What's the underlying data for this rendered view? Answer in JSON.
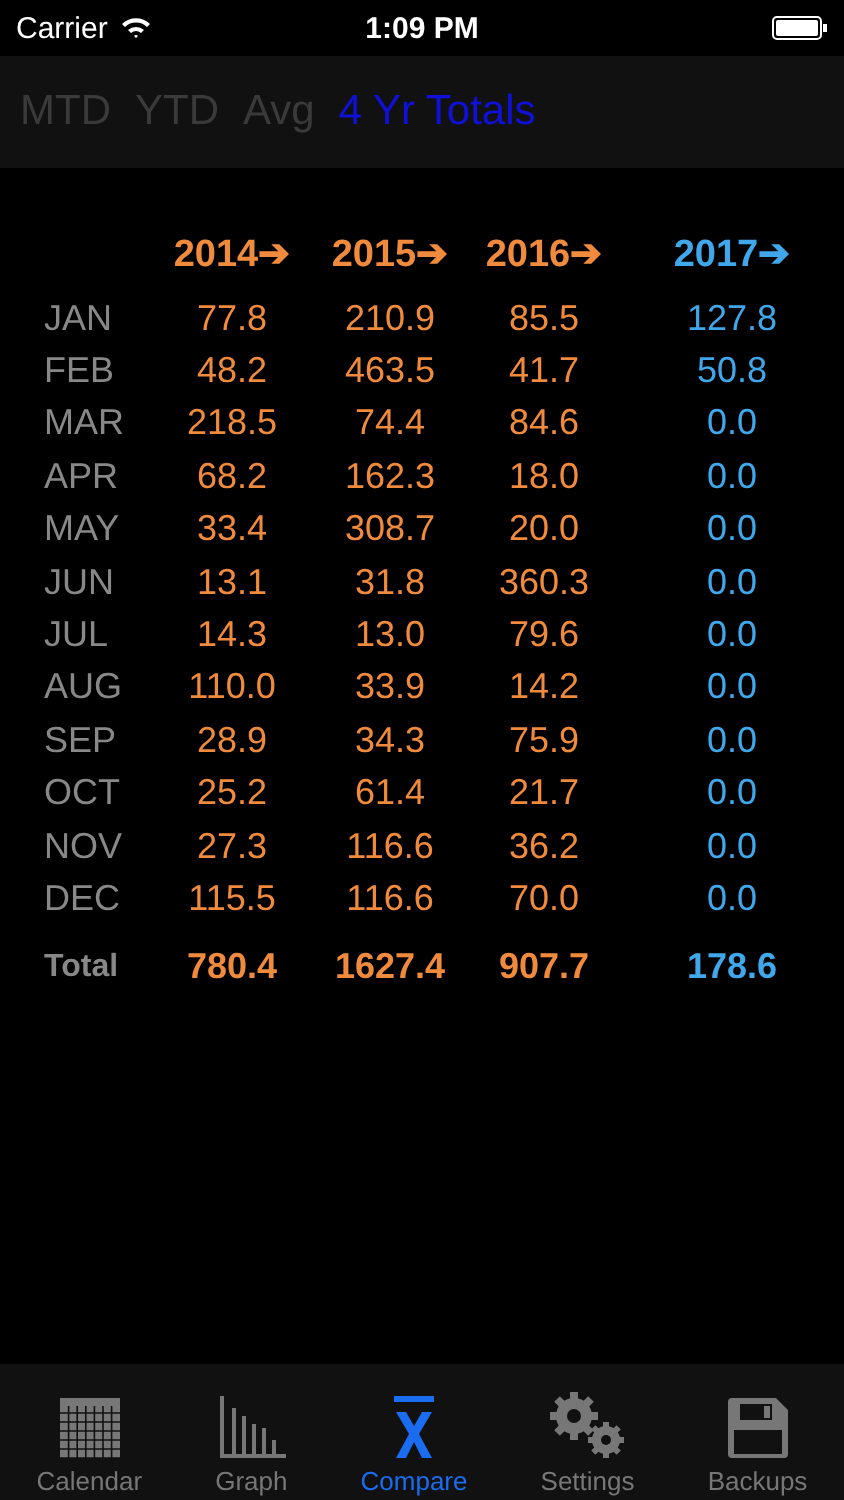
{
  "status_bar": {
    "carrier": "Carrier",
    "time": "1:09 PM"
  },
  "segments": [
    {
      "label": "MTD",
      "selected": false
    },
    {
      "label": "YTD",
      "selected": false
    },
    {
      "label": "Avg",
      "selected": false
    },
    {
      "label": "4 Yr Totals",
      "selected": true
    }
  ],
  "table": {
    "columns": [
      {
        "label": "2014➔",
        "current": false
      },
      {
        "label": "2015➔",
        "current": false
      },
      {
        "label": "2016➔",
        "current": false
      },
      {
        "label": "2017➔",
        "current": true
      }
    ],
    "rows": [
      {
        "month": "JAN",
        "values": [
          "77.8",
          "210.9",
          "85.5",
          "127.8"
        ]
      },
      {
        "month": "FEB",
        "values": [
          "48.2",
          "463.5",
          "41.7",
          "50.8"
        ]
      },
      {
        "month": "MAR",
        "values": [
          "218.5",
          "74.4",
          "84.6",
          "0.0"
        ]
      },
      {
        "month": "APR",
        "values": [
          "68.2",
          "162.3",
          "18.0",
          "0.0"
        ]
      },
      {
        "month": "MAY",
        "values": [
          "33.4",
          "308.7",
          "20.0",
          "0.0"
        ]
      },
      {
        "month": "JUN",
        "values": [
          "13.1",
          "31.8",
          "360.3",
          "0.0"
        ]
      },
      {
        "month": "JUL",
        "values": [
          "14.3",
          "13.0",
          "79.6",
          "0.0"
        ]
      },
      {
        "month": "AUG",
        "values": [
          "110.0",
          "33.9",
          "14.2",
          "0.0"
        ]
      },
      {
        "month": "SEP",
        "values": [
          "28.9",
          "34.3",
          "75.9",
          "0.0"
        ]
      },
      {
        "month": "OCT",
        "values": [
          "25.2",
          "61.4",
          "21.7",
          "0.0"
        ]
      },
      {
        "month": "NOV",
        "values": [
          "27.3",
          "116.6",
          "36.2",
          "0.0"
        ]
      },
      {
        "month": "DEC",
        "values": [
          "115.5",
          "116.6",
          "70.0",
          "0.0"
        ]
      }
    ],
    "total": {
      "label": "Total",
      "values": [
        "780.4",
        "1627.4",
        "907.7",
        "178.6"
      ]
    }
  },
  "tab_bar": [
    {
      "label": "Calendar",
      "kind": "calendar",
      "selected": false
    },
    {
      "label": "Graph",
      "kind": "graph",
      "selected": false
    },
    {
      "label": "Compare",
      "kind": "xbar",
      "selected": true
    },
    {
      "label": "Settings",
      "kind": "gears",
      "selected": false
    },
    {
      "label": "Backups",
      "kind": "disk",
      "selected": false
    }
  ]
}
